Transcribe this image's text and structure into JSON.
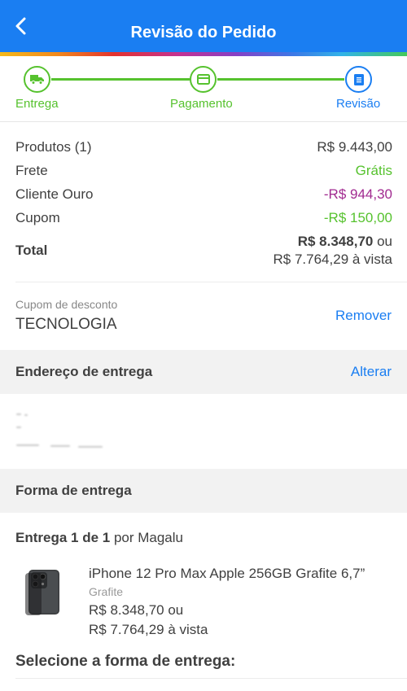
{
  "header": {
    "title": "Revisão do Pedido"
  },
  "steps": [
    {
      "label": "Entrega",
      "icon": "truck-icon",
      "state": "done"
    },
    {
      "label": "Pagamento",
      "icon": "card-icon",
      "state": "done"
    },
    {
      "label": "Revisão",
      "icon": "document-icon",
      "state": "current"
    }
  ],
  "summary": {
    "products_label": "Produtos (1)",
    "products_value": "R$ 9.443,00",
    "shipping_label": "Frete",
    "shipping_value": "Grátis",
    "club_label": "Cliente Ouro",
    "club_value": "-R$ 944,30",
    "coupon_label": "Cupom",
    "coupon_value": "-R$ 150,00",
    "total_label": "Total",
    "total_value": "R$ 8.348,70",
    "total_or": " ou",
    "total_cash": "R$ 7.764,29 à vista"
  },
  "coupon": {
    "caption": "Cupom de desconto",
    "code": "TECNOLOGIA",
    "remove_label": "Remover"
  },
  "address": {
    "title": "Endereço de entrega",
    "action": "Alterar"
  },
  "delivery": {
    "title": "Forma de entrega",
    "which_bold": "Entrega 1 de 1",
    "which_rest": " por Magalu",
    "product_name": "iPhone 12 Pro Max Apple 256GB Grafite 6,7”",
    "product_variant": "Grafite",
    "product_price": "R$ 8.348,70 ou",
    "product_cash": "R$ 7.764,29 à vista",
    "select_title": "Selecione a forma de entrega:"
  },
  "colors": {
    "accent": "#1a7ef2",
    "success": "#56c22e",
    "club": "#a12a90"
  }
}
